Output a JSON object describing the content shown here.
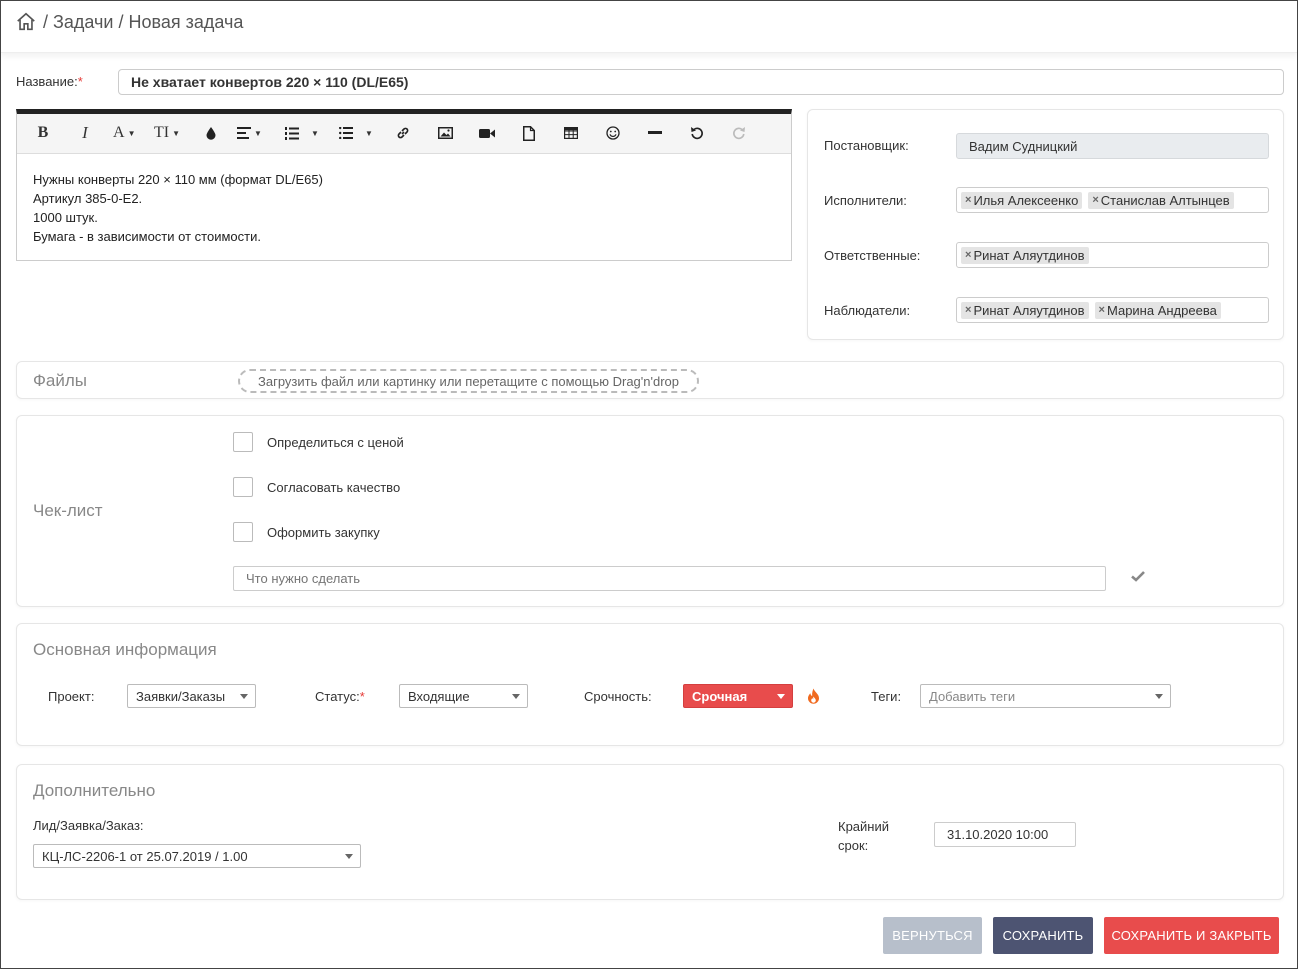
{
  "breadcrumb": {
    "home_icon": "home-icon",
    "separator": "/",
    "section": "Задачи",
    "current": "Новая задача"
  },
  "title_field": {
    "label": "Название:",
    "required_mark": "*",
    "value": "Не хватает конвертов 220 × 110 (DL/E65)"
  },
  "editor": {
    "toolbar": [
      "bold",
      "italic",
      "font-color",
      "text-size",
      "ink",
      "align",
      "ordered-list",
      "bulleted-list",
      "link",
      "image",
      "video",
      "file",
      "table",
      "emoji",
      "horizontal-rule",
      "undo",
      "redo"
    ],
    "bold_label": "B",
    "italic_label": "I",
    "fontcolor_label": "A",
    "textsize_label": "TI",
    "lines": [
      "Нужны конверты 220 × 110 мм (формат DL/E65)",
      "Артикул 385-0-E2.",
      "1000 штук.",
      "Бумага - в зависимости от стоимости."
    ]
  },
  "people": {
    "author": {
      "label": "Постановщик:",
      "value": "Вадим Судницкий"
    },
    "executors": {
      "label": "Исполнители:",
      "tags": [
        "Илья Алексеенко",
        "Станислав Алтынцев"
      ]
    },
    "responsible": {
      "label": "Ответственные:",
      "tags": [
        "Ринат Аляутдинов"
      ]
    },
    "observers": {
      "label": "Наблюдатели:",
      "tags": [
        "Ринат Аляутдинов",
        "Марина Андреева"
      ]
    },
    "tag_remove": "×"
  },
  "files": {
    "title": "Файлы",
    "upload_text": "Загрузить файл или картинку или перетащите с помощью Drag'n'drop"
  },
  "checklist": {
    "title": "Чек-лист",
    "items": [
      "Определиться с ценой",
      "Согласовать качество",
      "Оформить закупку"
    ],
    "new_item_placeholder": "Что нужно сделать"
  },
  "main_info": {
    "title": "Основная информация",
    "project": {
      "label": "Проект:",
      "value": "Заявки/Заказы"
    },
    "status": {
      "label": "Статус:",
      "required_mark": "*",
      "value": "Входящие"
    },
    "urgency": {
      "label": "Срочность:",
      "value": "Срочная",
      "color": "#e84c4c",
      "icon": "fire-icon"
    },
    "tags": {
      "label": "Теги:",
      "placeholder": "Добавить теги"
    }
  },
  "extra": {
    "title": "Дополнительно",
    "lead": {
      "label": "Лид/Заявка/Заказ:",
      "value": "КЦ-ЛС-2206-1 от 25.07.2019 / 1.00"
    },
    "deadline": {
      "label_line1": "Крайний",
      "label_line2": "срок:",
      "value": "31.10.2020 10:00"
    }
  },
  "buttons": {
    "back": {
      "label": "ВЕРНУТЬСЯ",
      "color": "#b7bfcb"
    },
    "save": {
      "label": "СОХРАНИТЬ",
      "color": "#4d5472"
    },
    "save_close": {
      "label": "СОХРАНИТЬ И ЗАКРЫТЬ",
      "color": "#e84c4c"
    }
  }
}
